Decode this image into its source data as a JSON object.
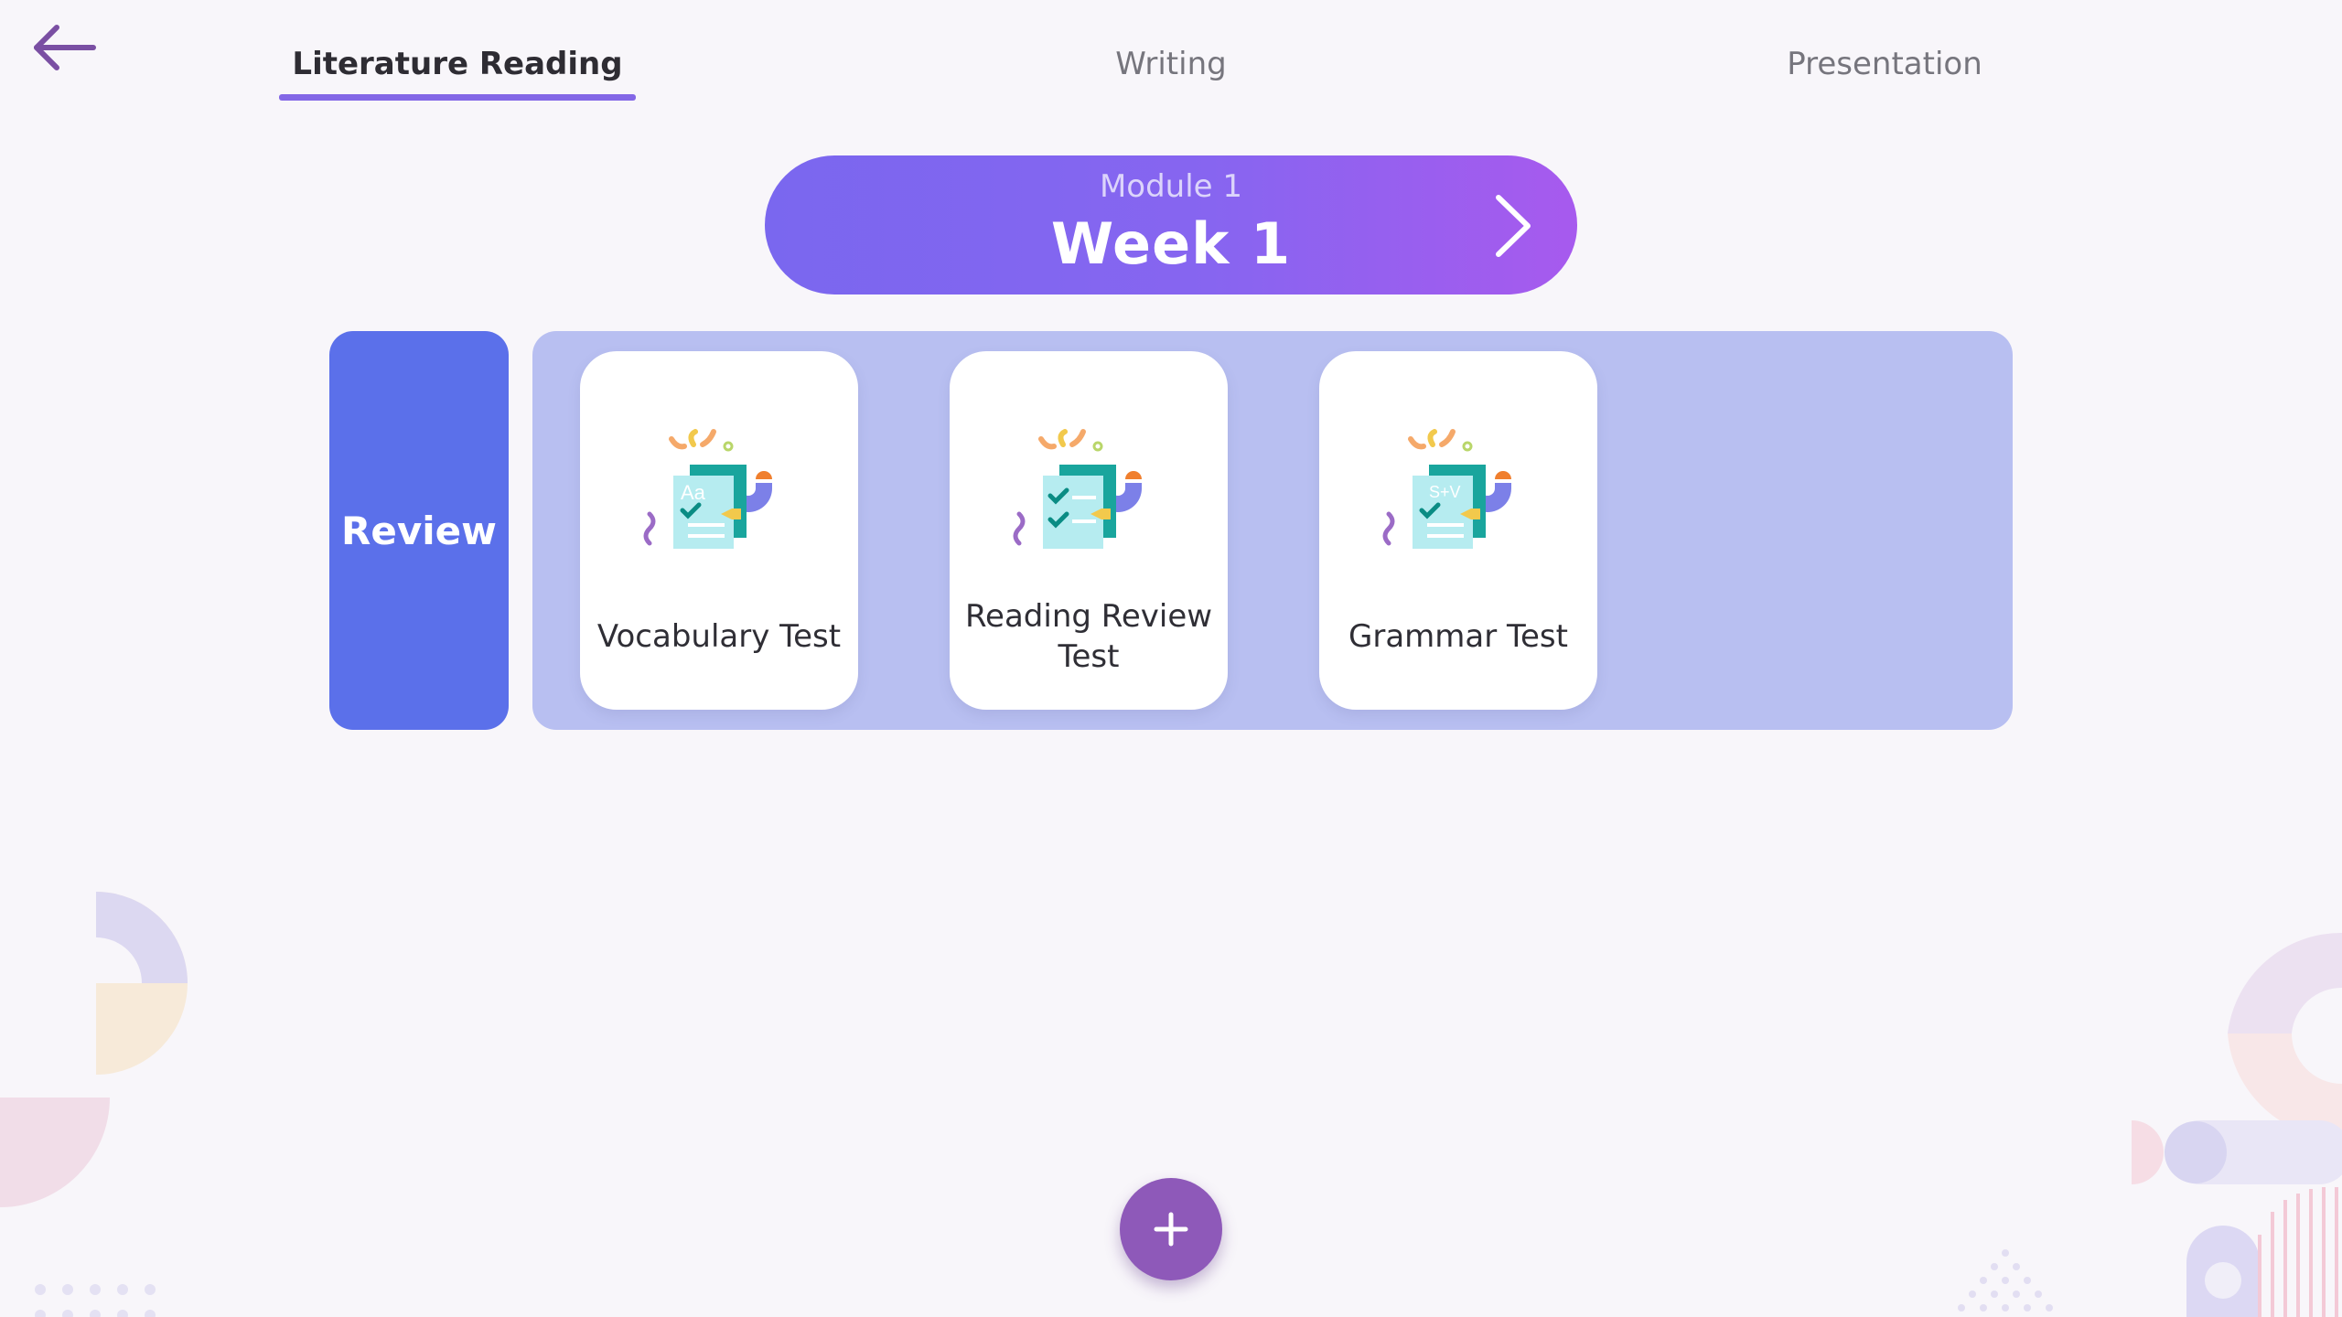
{
  "nav": {
    "back_icon": "arrow-left-icon",
    "tabs": [
      {
        "label": "Literature Reading",
        "active": true
      },
      {
        "label": "Writing",
        "active": false
      },
      {
        "label": "Presentation",
        "active": false
      }
    ]
  },
  "module": {
    "label": "Module 1",
    "week": "Week 1",
    "next_icon": "chevron-right-icon"
  },
  "section": {
    "label": "Review",
    "cards": [
      {
        "title": "Vocabulary Test",
        "icon": "vocabulary-test-icon",
        "icon_text": "Aa"
      },
      {
        "title": "Reading Review Test",
        "icon": "reading-review-test-icon",
        "icon_text": ""
      },
      {
        "title": "Grammar Test",
        "icon": "grammar-test-icon",
        "icon_text": "S+V"
      }
    ]
  },
  "add_button": {
    "icon": "plus-icon"
  },
  "colors": {
    "accent": "#8367e6",
    "banner_start": "#7a67ef",
    "banner_end": "#a75aee",
    "review_tab": "#5b70ea",
    "panel": "#b8bff1",
    "add_button": "#8e59b9"
  }
}
